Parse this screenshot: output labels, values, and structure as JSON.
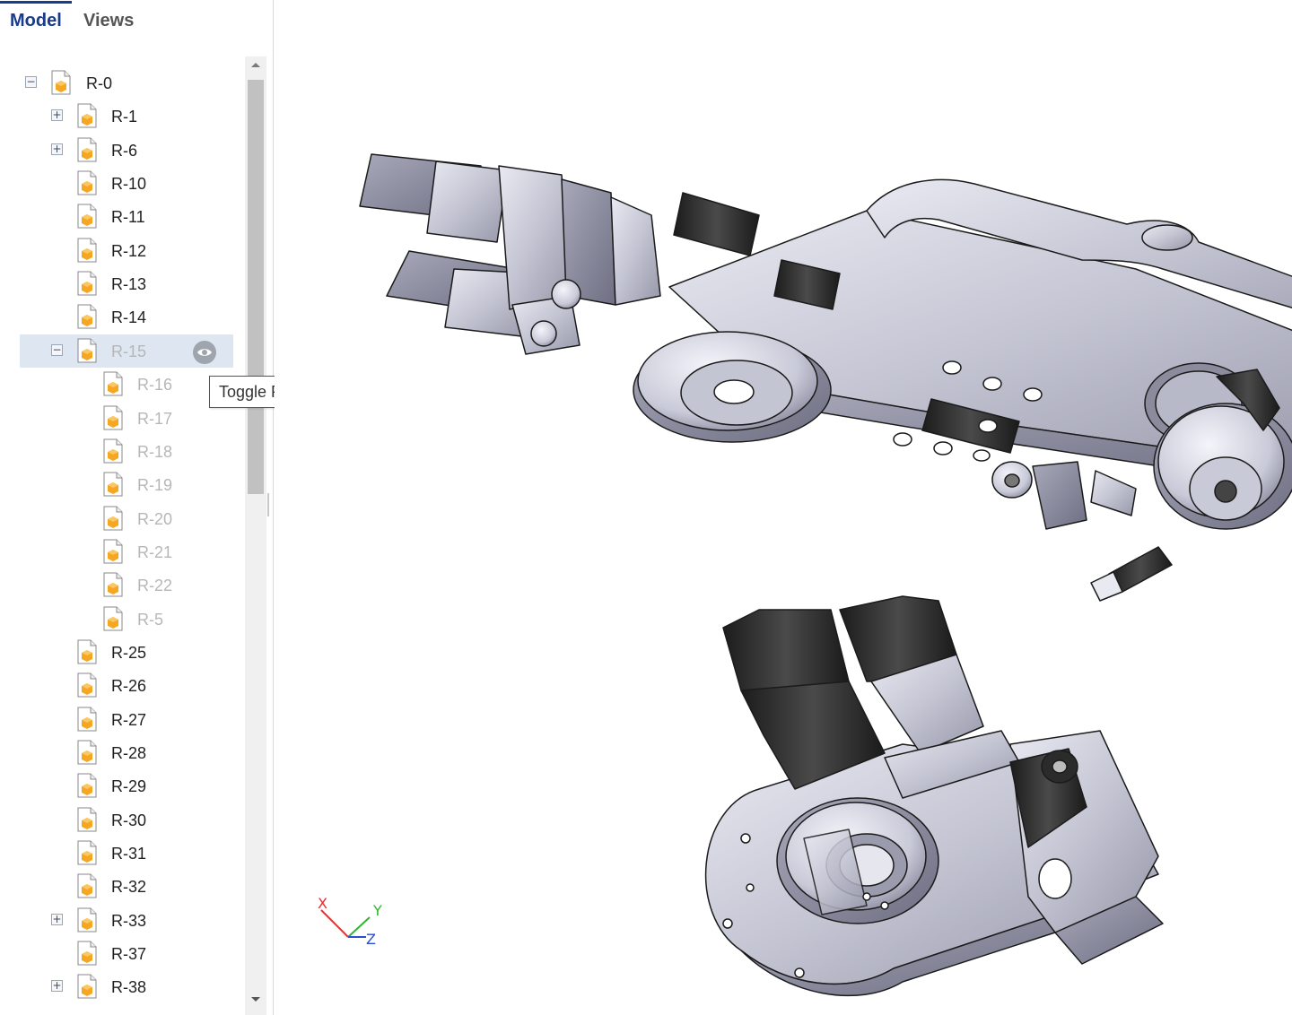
{
  "tabs": [
    {
      "label": "Model",
      "active": true
    },
    {
      "label": "Views",
      "active": false
    }
  ],
  "tree": {
    "items": [
      {
        "label": "R-0",
        "level": 0,
        "expander": "minus",
        "dim": false
      },
      {
        "label": "R-1",
        "level": 1,
        "expander": "plus",
        "dim": false
      },
      {
        "label": "R-6",
        "level": 1,
        "expander": "plus",
        "dim": false
      },
      {
        "label": "R-10",
        "level": 1,
        "expander": "",
        "dim": false
      },
      {
        "label": "R-11",
        "level": 1,
        "expander": "",
        "dim": false
      },
      {
        "label": "R-12",
        "level": 1,
        "expander": "",
        "dim": false
      },
      {
        "label": "R-13",
        "level": 1,
        "expander": "",
        "dim": false
      },
      {
        "label": "R-14",
        "level": 1,
        "expander": "",
        "dim": false
      },
      {
        "label": "R-15",
        "level": 1,
        "expander": "minus",
        "dim": true,
        "selected": true
      },
      {
        "label": "R-16",
        "level": 2,
        "expander": "",
        "dim": true
      },
      {
        "label": "R-17",
        "level": 2,
        "expander": "",
        "dim": true
      },
      {
        "label": "R-18",
        "level": 2,
        "expander": "",
        "dim": true
      },
      {
        "label": "R-19",
        "level": 2,
        "expander": "",
        "dim": true
      },
      {
        "label": "R-20",
        "level": 2,
        "expander": "",
        "dim": true
      },
      {
        "label": "R-21",
        "level": 2,
        "expander": "",
        "dim": true
      },
      {
        "label": "R-22",
        "level": 2,
        "expander": "",
        "dim": true
      },
      {
        "label": "R-5",
        "level": 2,
        "expander": "",
        "dim": true
      },
      {
        "label": "R-25",
        "level": 1,
        "expander": "",
        "dim": false
      },
      {
        "label": "R-26",
        "level": 1,
        "expander": "",
        "dim": false
      },
      {
        "label": "R-27",
        "level": 1,
        "expander": "",
        "dim": false
      },
      {
        "label": "R-28",
        "level": 1,
        "expander": "",
        "dim": false
      },
      {
        "label": "R-29",
        "level": 1,
        "expander": "",
        "dim": false
      },
      {
        "label": "R-30",
        "level": 1,
        "expander": "",
        "dim": false
      },
      {
        "label": "R-31",
        "level": 1,
        "expander": "",
        "dim": false
      },
      {
        "label": "R-32",
        "level": 1,
        "expander": "",
        "dim": false
      },
      {
        "label": "R-33",
        "level": 1,
        "expander": "plus",
        "dim": false
      },
      {
        "label": "R-37",
        "level": 1,
        "expander": "",
        "dim": false
      },
      {
        "label": "R-38",
        "level": 1,
        "expander": "plus",
        "dim": false
      }
    ]
  },
  "tooltip": {
    "text": "Toggle Part Display"
  },
  "axis": {
    "x": "X",
    "y": "Y",
    "z": "Z"
  },
  "icons": {
    "tree_item": "part-file-icon",
    "visibility": "eye-icon"
  },
  "colors": {
    "accent": "#1a3a8c",
    "selection": "#dde6f1",
    "part_icon": "#f5a623",
    "axis_x": "#e03030",
    "axis_y": "#2fb52f",
    "axis_z": "#2a4fd6"
  }
}
